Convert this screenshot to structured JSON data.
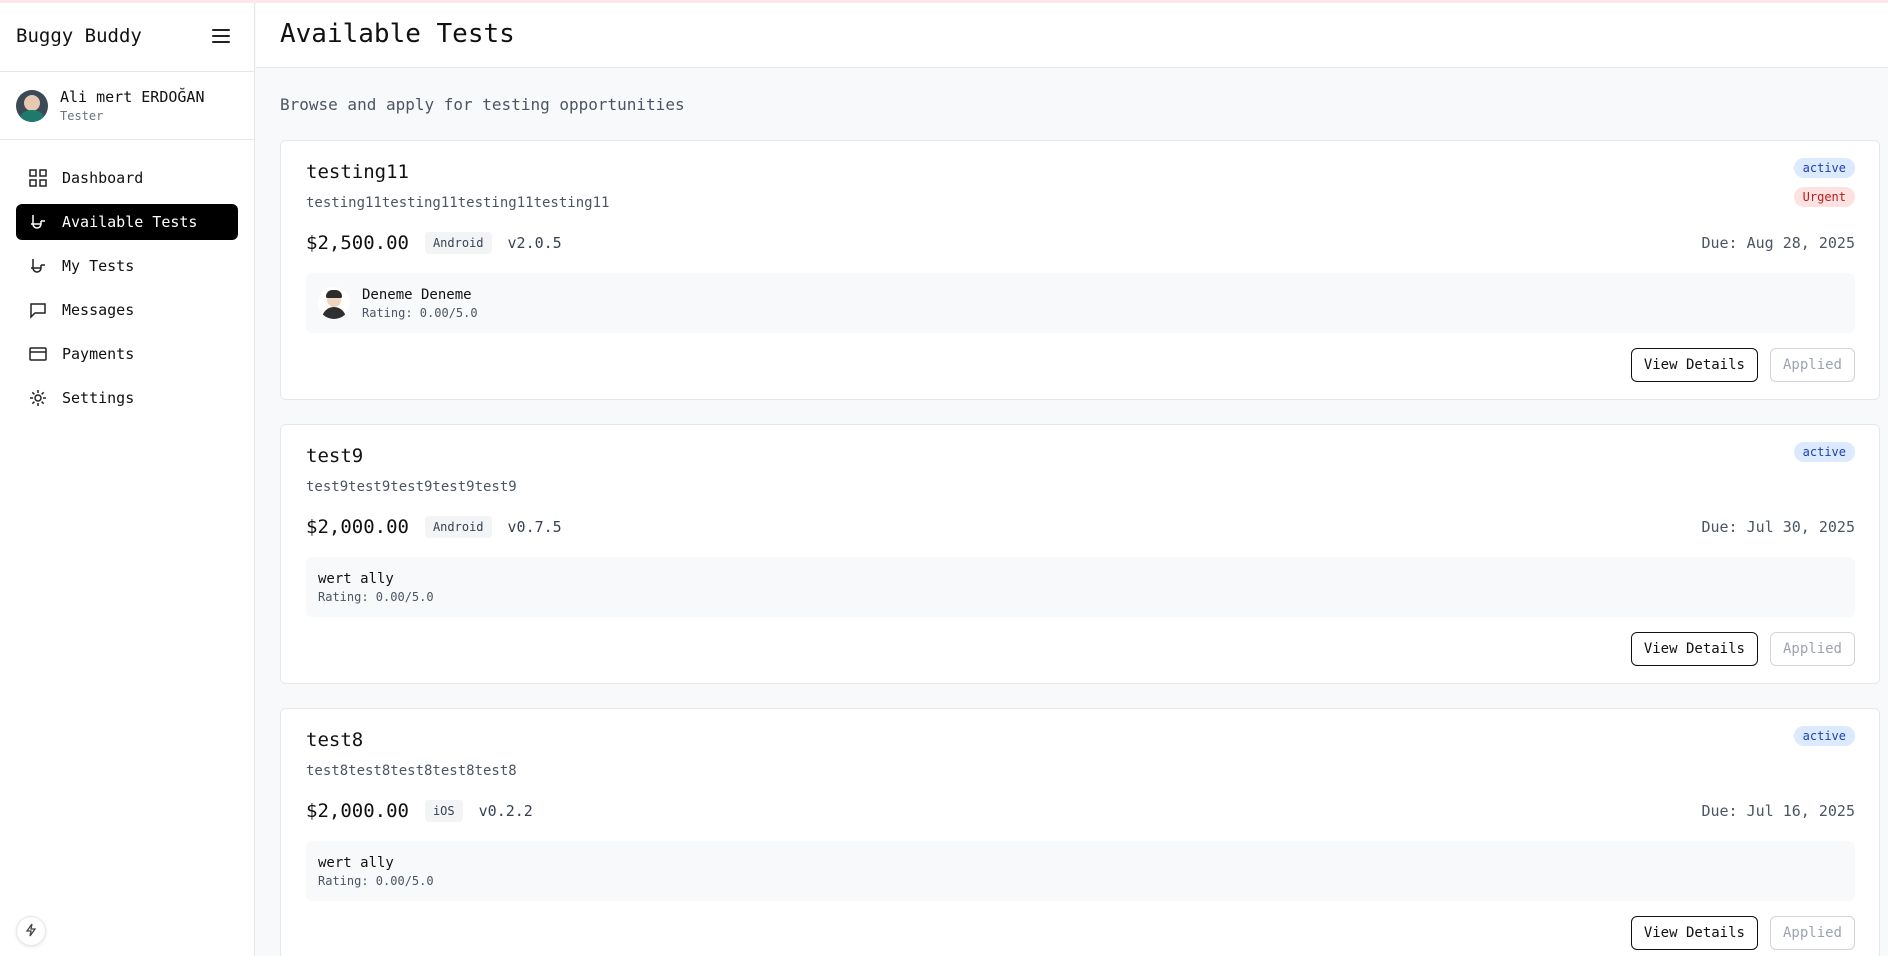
{
  "app": {
    "title": "Buggy Buddy"
  },
  "user": {
    "name": "Ali mert ERDOĞAN",
    "role": "Tester"
  },
  "sidebar": {
    "items": [
      {
        "label": "Dashboard",
        "icon": "grid-icon",
        "active": false
      },
      {
        "label": "Available Tests",
        "icon": "test-tube-icon",
        "active": true
      },
      {
        "label": "My Tests",
        "icon": "test-tube-icon",
        "active": false
      },
      {
        "label": "Messages",
        "icon": "message-icon",
        "active": false
      },
      {
        "label": "Payments",
        "icon": "credit-card-icon",
        "active": false
      },
      {
        "label": "Settings",
        "icon": "sun-gear-icon",
        "active": false
      }
    ]
  },
  "header": {
    "title": "Available Tests"
  },
  "main": {
    "subtitle": "Browse and apply for testing opportunities",
    "tests": [
      {
        "title": "testing11",
        "description": "testing11testing11testing11testing11",
        "status": "active",
        "urgent": "Urgent",
        "price": "$2,500.00",
        "platform": "Android",
        "version": "v2.0.5",
        "due": "Due: Aug 28, 2025",
        "owner": {
          "name": "Deneme Deneme",
          "rating": "Rating: 0.00/5.0"
        },
        "view_label": "View Details",
        "applied_label": "Applied"
      },
      {
        "title": "test9",
        "description": "test9test9test9test9test9",
        "status": "active",
        "price": "$2,000.00",
        "platform": "Android",
        "version": "v0.7.5",
        "due": "Due: Jul 30, 2025",
        "owner": {
          "name": "wert ally",
          "rating": "Rating: 0.00/5.0"
        },
        "view_label": "View Details",
        "applied_label": "Applied"
      },
      {
        "title": "test8",
        "description": "test8test8test8test8test8",
        "status": "active",
        "price": "$2,000.00",
        "platform": "iOS",
        "version": "v0.2.2",
        "due": "Due: Jul 16, 2025",
        "owner": {
          "name": "wert ally",
          "rating": "Rating: 0.00/5.0"
        },
        "view_label": "View Details",
        "applied_label": "Applied"
      }
    ]
  },
  "colors": {
    "active_nav": "#000000",
    "status_badge_bg": "#dbeafe",
    "urgent_badge_bg": "#fee2e2"
  }
}
